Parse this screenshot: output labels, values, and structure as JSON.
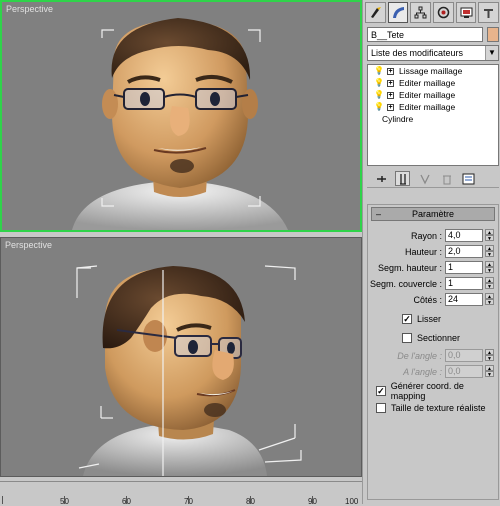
{
  "viewports": {
    "top_label": "Perspective",
    "bottom_label": "Perspective"
  },
  "ruler": {
    "ticks": [
      "50",
      "60",
      "70",
      "80",
      "90",
      "100"
    ]
  },
  "panel": {
    "tabs": [
      "create-icon",
      "modify-icon",
      "hierarchy-icon",
      "motion-icon",
      "display-icon",
      "utilities-icon"
    ],
    "object_name": "B__Tete",
    "object_color": "#e8b48c",
    "modifier_list": "Liste des modificateurs",
    "stack": [
      "Lissage maillage",
      "Editer maillage",
      "Editer maillage",
      "Editer maillage"
    ],
    "stack_base": "Cylindre",
    "rollout_title": "Paramètre",
    "params": {
      "rayon_label": "Rayon :",
      "rayon_value": "4,0",
      "hauteur_label": "Hauteur :",
      "hauteur_value": "2,0",
      "segm_hauteur_label": "Segm. hauteur :",
      "segm_hauteur_value": "1",
      "segm_couvercle_label": "Segm. couvercle :",
      "segm_couvercle_value": "1",
      "cotes_label": "Côtés :",
      "cotes_value": "24",
      "lisser_label": "Lisser",
      "sectionner_label": "Sectionner",
      "de_angle_label": "De l'angle :",
      "de_angle_value": "0,0",
      "a_angle_label": "A l'angle :",
      "a_angle_value": "0,0",
      "generer_label": "Générer coord. de mapping",
      "texture_label": "Taille de texture réaliste"
    }
  }
}
